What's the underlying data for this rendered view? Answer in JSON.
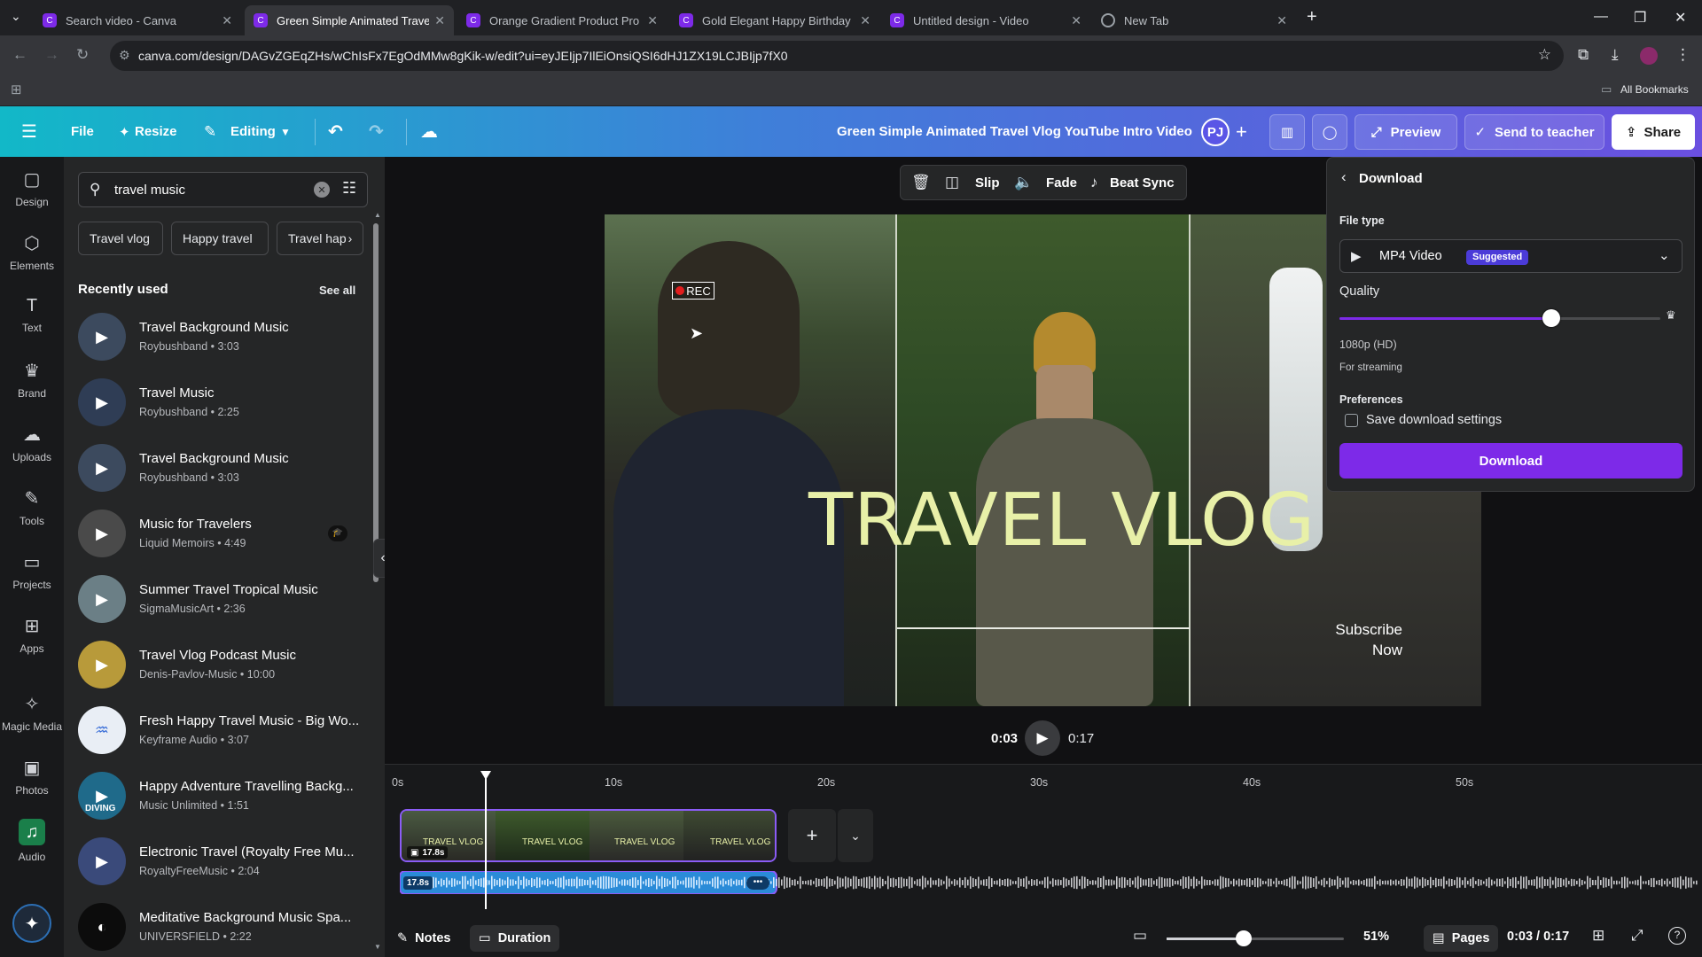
{
  "browser": {
    "tabs": [
      {
        "title": "Search video - Canva",
        "type": "canva"
      },
      {
        "title": "Green Simple Animated Travel V",
        "type": "canva",
        "active": true
      },
      {
        "title": "Orange Gradient Product Prom",
        "type": "canva"
      },
      {
        "title": "Gold Elegant Happy Birthday Vi",
        "type": "canva"
      },
      {
        "title": "Untitled design - Video",
        "type": "canva"
      },
      {
        "title": "New Tab",
        "type": "chrome"
      }
    ],
    "url": "canva.com/design/DAGvZGEqZHs/wChIsFx7EgOdMMw8gKik-w/edit?ui=eyJEIjp7IlEiOnsiQSI6dHJ1ZX19LCJBIjp7fX0",
    "bookmarks_label": "All Bookmarks"
  },
  "header": {
    "file": "File",
    "resize": "Resize",
    "editing": "Editing",
    "design_title": "Green Simple Animated Travel Vlog YouTube Intro Video",
    "avatar": "PJ",
    "preview": "Preview",
    "send_to_teacher": "Send to teacher",
    "share": "Share"
  },
  "rail": [
    {
      "label": "Design",
      "icon": "▢"
    },
    {
      "label": "Elements",
      "icon": "⬡"
    },
    {
      "label": "Text",
      "icon": "T"
    },
    {
      "label": "Brand",
      "icon": "♛"
    },
    {
      "label": "Uploads",
      "icon": "☁"
    },
    {
      "label": "Tools",
      "icon": "✎"
    },
    {
      "label": "Projects",
      "icon": "▭"
    },
    {
      "label": "Apps",
      "icon": "⊞"
    },
    {
      "label": "Magic Media",
      "icon": "✧"
    },
    {
      "label": "Photos",
      "icon": "▣"
    },
    {
      "label": "Audio",
      "icon": "♫"
    }
  ],
  "panel": {
    "search_value": "travel music",
    "chips": [
      "Travel vlog",
      "Happy travel",
      "Travel hap"
    ],
    "section_title": "Recently used",
    "see_all": "See all",
    "tracks": [
      {
        "title": "Travel Background Music",
        "sub": "Roybushband • 3:03",
        "color": "#3c4a5e"
      },
      {
        "title": "Travel Music",
        "sub": "Roybushband • 2:25",
        "color": "#2f3d55"
      },
      {
        "title": "Travel Background Music",
        "sub": "Roybushband • 3:03",
        "color": "#3c4a5e"
      },
      {
        "title": "Music for Travelers",
        "sub": "Liquid Memoirs • 4:49",
        "color": "#4a4a4a"
      },
      {
        "title": "Summer Travel Tropical Music",
        "sub": "SigmaMusicArt • 2:36",
        "color": "#6b7f86"
      },
      {
        "title": "Travel Vlog Podcast Music",
        "sub": "Denis-Pavlov-Music • 10:00",
        "color": "#b89a3a"
      },
      {
        "title": "Fresh Happy Travel Music - Big Wo...",
        "sub": "Keyframe Audio • 3:07",
        "color": "#e9eef5"
      },
      {
        "title": "Happy Adventure Travelling Backg...",
        "sub": "Music Unlimited • 1:51",
        "color": "#1f6a8a",
        "thumb_text": "DIVING"
      },
      {
        "title": "Electronic Travel (Royalty Free Mu...",
        "sub": "RoyaltyFreeMusic • 2:04",
        "color": "#3a4a7a"
      },
      {
        "title": "Meditative Background Music Spa...",
        "sub": "UNIVERSFIELD • 2:22",
        "color": "#0c0c0c"
      }
    ]
  },
  "toolbar": {
    "slip": "Slip",
    "fade": "Fade",
    "beat_sync": "Beat Sync"
  },
  "design": {
    "rec": "REC",
    "headline": "TRAVEL VLOG",
    "subscribe_line1": "Subscribe",
    "subscribe_line2": "Now",
    "headline_color": "#e8f0a8"
  },
  "download": {
    "title": "Download",
    "file_type_label": "File type",
    "file_type_value": "MP4 Video",
    "suggested": "Suggested",
    "quality_label": "Quality",
    "quality_fraction": 0.66,
    "quality_value": "1080p (HD)",
    "quality_note": "For streaming",
    "preferences_label": "Preferences",
    "save_settings": "Save download settings",
    "download_button": "Download",
    "accent": "#7d2ae8"
  },
  "playback": {
    "current": "0:03",
    "total": "0:17"
  },
  "timeline": {
    "ticks": [
      "0s",
      "10s",
      "20s",
      "30s",
      "40s",
      "50s"
    ],
    "clip_label": "TRAVEL VLOG",
    "clip_duration": "17.8s",
    "audio_duration": "17.8s"
  },
  "bottombar": {
    "notes": "Notes",
    "duration": "Duration",
    "zoom": "51%",
    "pages": "Pages",
    "time": "0:03 / 0:17"
  }
}
